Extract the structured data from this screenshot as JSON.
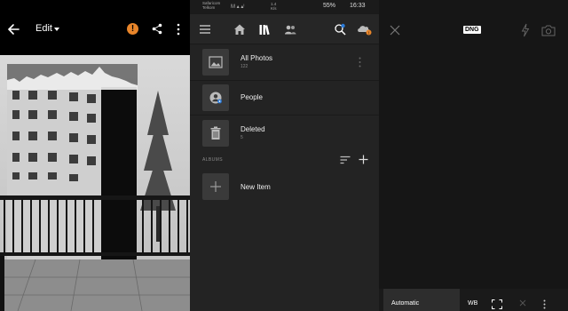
{
  "editor": {
    "edit_label": "Edit",
    "warning_badge": "!"
  },
  "library": {
    "status": {
      "carrier_line1": "Safaricom",
      "carrier_line2": "Telkom",
      "signal": "M ▴ ▴ᴵ",
      "net_line1": "1.4",
      "net_line2": "K/s",
      "battery": "55%",
      "time": "16:33"
    },
    "rows": [
      {
        "title": "All Photos",
        "count": "122"
      },
      {
        "title": "People",
        "count": ""
      },
      {
        "title": "Deleted",
        "count": "5"
      }
    ],
    "albums_label": "ALBUMS",
    "new_item_label": "New Item"
  },
  "camera": {
    "format_badge": "DNG",
    "mode_label": "Automatic",
    "wb_label": "WB"
  },
  "colors": {
    "accent_orange": "#e8852a",
    "badge_blue": "#2b7bd9",
    "panel_bg": "#232323",
    "item_bg": "#3a3a3a"
  },
  "icons": [
    "back-arrow-icon",
    "caret-down-icon",
    "warning-icon",
    "share-icon",
    "more-vertical-icon",
    "hamburger-menu-icon",
    "home-icon",
    "library-icon",
    "people-icon",
    "search-people-icon",
    "cloud-sync-icon",
    "image-icon",
    "person-icon",
    "trash-icon",
    "sort-icon",
    "plus-icon",
    "close-icon",
    "flash-off-icon",
    "camera-switch-icon",
    "expand-icon"
  ]
}
